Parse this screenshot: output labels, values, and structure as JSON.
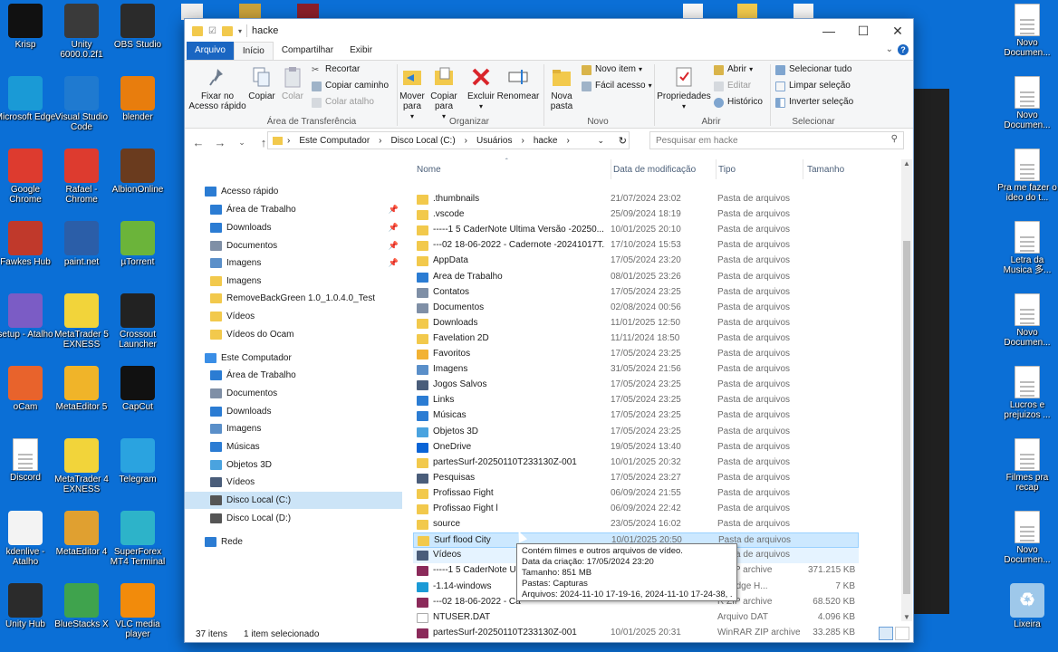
{
  "desktop": {
    "left_icons": [
      {
        "label": "Krisp",
        "icon": "krisp-icon",
        "color": "#111111"
      },
      {
        "label": "Unity 6000.0.2f1",
        "icon": "unity-icon",
        "color": "#3a3a3a"
      },
      {
        "label": "OBS Studio",
        "icon": "obs-icon",
        "color": "#2b2b2b"
      },
      {
        "label": "Microsoft Edge",
        "icon": "edge-icon",
        "color": "#1a9ad6"
      },
      {
        "label": "Visual Studio Code",
        "icon": "vscode-icon",
        "color": "#1f7ad0"
      },
      {
        "label": "blender",
        "icon": "blender-icon",
        "color": "#e87d0d"
      },
      {
        "label": "Google Chrome",
        "icon": "chrome-icon",
        "color": "#dd3b2f"
      },
      {
        "label": "Rafael - Chrome",
        "icon": "chrome-icon",
        "color": "#dd3b2f"
      },
      {
        "label": "AlbionOnline",
        "icon": "albion-icon",
        "color": "#6a3b1e"
      },
      {
        "label": "Fawkes Hub",
        "icon": "fawkes-icon",
        "color": "#c0392b"
      },
      {
        "label": "paint.net",
        "icon": "paintnet-icon",
        "color": "#2b5ea8"
      },
      {
        "label": "µTorrent",
        "icon": "utorrent-icon",
        "color": "#6bb43a"
      },
      {
        "label": "setup - Atalho",
        "icon": "setup-icon",
        "color": "#7b5cc5"
      },
      {
        "label": "MetaTrader 5 EXNESS",
        "icon": "exness-icon",
        "color": "#f2d43a"
      },
      {
        "label": "Crossout Launcher",
        "icon": "crossout-icon",
        "color": "#222222"
      },
      {
        "label": "oCam",
        "icon": "ocam-icon",
        "color": "#e8632c"
      },
      {
        "label": "MetaEditor 5",
        "icon": "metaeditor-icon",
        "color": "#f0b429"
      },
      {
        "label": "CapCut",
        "icon": "capcut-icon",
        "color": "#111111"
      },
      {
        "label": "Discord",
        "icon": "file-icon",
        "color": "#ffffff"
      },
      {
        "label": "MetaTrader 4 EXNESS",
        "icon": "exness-icon",
        "color": "#f2d43a"
      },
      {
        "label": "Telegram",
        "icon": "telegram-icon",
        "color": "#2aa3e0"
      },
      {
        "label": "kdenlive - Atalho",
        "icon": "kdenlive-icon",
        "color": "#f3f3f3"
      },
      {
        "label": "MetaEditor 4",
        "icon": "metaeditor-icon",
        "color": "#e0a030"
      },
      {
        "label": "SuperForex MT4 Terminal",
        "icon": "superforex-icon",
        "color": "#2db3c9"
      },
      {
        "label": "Unity Hub",
        "icon": "unity-icon",
        "color": "#2b2b2b"
      },
      {
        "label": "BlueStacks X",
        "icon": "bluestacks-icon",
        "color": "#3fa34d"
      },
      {
        "label": "VLC media player",
        "icon": "vlc-icon",
        "color": "#f28b0b"
      }
    ],
    "right_icons": [
      {
        "label": "Novo Documen..."
      },
      {
        "label": "Novo Documen..."
      },
      {
        "label": "Pra me fazer o ideo do t..."
      },
      {
        "label": "Letra da Musica 多..."
      },
      {
        "label": "Novo Documen..."
      },
      {
        "label": "Lucros e prejuizos ..."
      },
      {
        "label": "Filmes pra recap"
      },
      {
        "label": "Novo Documen..."
      },
      {
        "label": "Lixeira"
      }
    ]
  },
  "window": {
    "title": "hacke",
    "tabs": {
      "file": "Arquivo",
      "home": "Início",
      "share": "Compartilhar",
      "view": "Exibir"
    },
    "ribbon": {
      "pin": "Fixar no Acesso rápido",
      "copy": "Copiar",
      "paste": "Colar",
      "cut": "Recortar",
      "copy_path": "Copiar caminho",
      "paste_shortcut": "Colar atalho",
      "clipboard_group": "Área de Transferência",
      "move_to": "Mover para",
      "copy_to": "Copiar para",
      "delete": "Excluir",
      "rename": "Renomear",
      "organize_group": "Organizar",
      "new_folder": "Nova pasta",
      "new_item": "Novo item",
      "easy_access": "Fácil acesso",
      "new_group": "Novo",
      "properties": "Propriedades",
      "open": "Abrir",
      "edit": "Editar",
      "history": "Histórico",
      "open_group": "Abrir",
      "select_all": "Selecionar tudo",
      "select_none": "Limpar seleção",
      "invert": "Inverter seleção",
      "select_group": "Selecionar"
    },
    "address": {
      "crumbs": [
        "Este Computador",
        "Disco Local (C:)",
        "Usuários",
        "hacke"
      ],
      "search_placeholder": "Pesquisar em hacke"
    },
    "nav": [
      {
        "label": "Acesso rápido",
        "icon": "star-icon",
        "color": "#2b7cd3",
        "level": 0
      },
      {
        "label": "Área de Trabalho",
        "icon": "desktop-icon",
        "color": "#2b7cd3",
        "level": 1,
        "pin": true
      },
      {
        "label": "Downloads",
        "icon": "download-icon",
        "color": "#2b7cd3",
        "level": 1,
        "pin": true
      },
      {
        "label": "Documentos",
        "icon": "documents-icon",
        "color": "#7f8fa6",
        "level": 1,
        "pin": true
      },
      {
        "label": "Imagens",
        "icon": "pictures-icon",
        "color": "#5a8fc9",
        "level": 1,
        "pin": true
      },
      {
        "label": "Imagens",
        "icon": "folder-icon",
        "color": "#f2c94c",
        "level": 1
      },
      {
        "label": "RemoveBackGreen 1.0_1.0.4.0_Test",
        "icon": "folder-icon",
        "color": "#f2c94c",
        "level": 1
      },
      {
        "label": "Vídeos",
        "icon": "folder-icon",
        "color": "#f2c94c",
        "level": 1
      },
      {
        "label": "Vídeos do Ocam",
        "icon": "folder-icon",
        "color": "#f2c94c",
        "level": 1
      },
      {
        "label": "Este Computador",
        "icon": "computer-icon",
        "color": "#3a8ee6",
        "level": 0
      },
      {
        "label": "Área de Trabalho",
        "icon": "desktop-icon",
        "color": "#2b7cd3",
        "level": 1
      },
      {
        "label": "Documentos",
        "icon": "documents-icon",
        "color": "#7f8fa6",
        "level": 1
      },
      {
        "label": "Downloads",
        "icon": "download-icon",
        "color": "#2b7cd3",
        "level": 1
      },
      {
        "label": "Imagens",
        "icon": "pictures-icon",
        "color": "#5a8fc9",
        "level": 1
      },
      {
        "label": "Músicas",
        "icon": "music-icon",
        "color": "#2b7cd3",
        "level": 1
      },
      {
        "label": "Objetos 3D",
        "icon": "3d-icon",
        "color": "#4aa3df",
        "level": 1
      },
      {
        "label": "Vídeos",
        "icon": "video-icon",
        "color": "#4a5d7a",
        "level": 1
      },
      {
        "label": "Disco Local (C:)",
        "icon": "drive-icon",
        "color": "#555555",
        "level": 1,
        "selected": true
      },
      {
        "label": "Disco Local (D:)",
        "icon": "drive-icon",
        "color": "#555555",
        "level": 1
      },
      {
        "label": "Rede",
        "icon": "network-icon",
        "color": "#2b7cd3",
        "level": 0
      }
    ],
    "columns": {
      "name": "Nome",
      "date": "Data de modificação",
      "type": "Tipo",
      "size": "Tamanho"
    },
    "files": [
      {
        "name": ".thumbnails",
        "date": "21/07/2024 23:02",
        "type": "Pasta de arquivos",
        "size": "",
        "icon": "folder-icon",
        "color": "#f2c94c"
      },
      {
        "name": ".vscode",
        "date": "25/09/2024 18:19",
        "type": "Pasta de arquivos",
        "size": "",
        "icon": "folder-icon",
        "color": "#f2c94c"
      },
      {
        "name": "-----1 5 CaderNote Ultima Versão -20250...",
        "date": "10/01/2025 20:10",
        "type": "Pasta de arquivos",
        "size": "",
        "icon": "folder-icon",
        "color": "#f2c94c"
      },
      {
        "name": "---02 18-06-2022 - Cadernote -20241017T...",
        "date": "17/10/2024 15:53",
        "type": "Pasta de arquivos",
        "size": "",
        "icon": "folder-icon",
        "color": "#f2c94c"
      },
      {
        "name": "AppData",
        "date": "17/05/2024 23:20",
        "type": "Pasta de arquivos",
        "size": "",
        "icon": "folder-icon",
        "color": "#f2c94c"
      },
      {
        "name": "Área de Trabalho",
        "date": "08/01/2025 23:26",
        "type": "Pasta de arquivos",
        "size": "",
        "icon": "desktop-icon",
        "color": "#2b7cd3"
      },
      {
        "name": "Contatos",
        "date": "17/05/2024 23:25",
        "type": "Pasta de arquivos",
        "size": "",
        "icon": "contacts-icon",
        "color": "#7f8fa6"
      },
      {
        "name": "Documentos",
        "date": "02/08/2024 00:56",
        "type": "Pasta de arquivos",
        "size": "",
        "icon": "documents-icon",
        "color": "#7f8fa6"
      },
      {
        "name": "Downloads",
        "date": "11/01/2025 12:50",
        "type": "Pasta de arquivos",
        "size": "",
        "icon": "folder-icon",
        "color": "#f2c94c"
      },
      {
        "name": "Favelation 2D",
        "date": "11/11/2024 18:50",
        "type": "Pasta de arquivos",
        "size": "",
        "icon": "folder-icon",
        "color": "#f2c94c"
      },
      {
        "name": "Favoritos",
        "date": "17/05/2024 23:25",
        "type": "Pasta de arquivos",
        "size": "",
        "icon": "star-icon",
        "color": "#f2b233"
      },
      {
        "name": "Imagens",
        "date": "31/05/2024 21:56",
        "type": "Pasta de arquivos",
        "size": "",
        "icon": "pictures-icon",
        "color": "#5a8fc9"
      },
      {
        "name": "Jogos Salvos",
        "date": "17/05/2024 23:25",
        "type": "Pasta de arquivos",
        "size": "",
        "icon": "saved-games-icon",
        "color": "#4a5d7a"
      },
      {
        "name": "Links",
        "date": "17/05/2024 23:25",
        "type": "Pasta de arquivos",
        "size": "",
        "icon": "link-icon",
        "color": "#2b7cd3"
      },
      {
        "name": "Músicas",
        "date": "17/05/2024 23:25",
        "type": "Pasta de arquivos",
        "size": "",
        "icon": "music-icon",
        "color": "#2b7cd3"
      },
      {
        "name": "Objetos 3D",
        "date": "17/05/2024 23:25",
        "type": "Pasta de arquivos",
        "size": "",
        "icon": "3d-icon",
        "color": "#4aa3df"
      },
      {
        "name": "OneDrive",
        "date": "19/05/2024 13:40",
        "type": "Pasta de arquivos",
        "size": "",
        "icon": "onedrive-icon",
        "color": "#0a64d6"
      },
      {
        "name": "partesSurf-20250110T233130Z-001",
        "date": "10/01/2025 20:32",
        "type": "Pasta de arquivos",
        "size": "",
        "icon": "folder-icon",
        "color": "#f2c94c"
      },
      {
        "name": "Pesquisas",
        "date": "17/05/2024 23:27",
        "type": "Pasta de arquivos",
        "size": "",
        "icon": "search-icon",
        "color": "#4a5d7a"
      },
      {
        "name": "Profissao Fight",
        "date": "06/09/2024 21:55",
        "type": "Pasta de arquivos",
        "size": "",
        "icon": "folder-icon",
        "color": "#f2c94c"
      },
      {
        "name": "Profissao Fight l",
        "date": "06/09/2024 22:42",
        "type": "Pasta de arquivos",
        "size": "",
        "icon": "folder-icon",
        "color": "#f2c94c"
      },
      {
        "name": "source",
        "date": "23/05/2024 16:02",
        "type": "Pasta de arquivos",
        "size": "",
        "icon": "folder-icon",
        "color": "#f2c94c"
      },
      {
        "name": "Surf flood City",
        "date": "10/01/2025 20:50",
        "type": "Pasta de arquivos",
        "size": "",
        "icon": "folder-icon",
        "color": "#f2c94c",
        "selected": true
      },
      {
        "name": "Vídeos",
        "date": "08/01/2025 18:13",
        "type": "Pasta de arquivos",
        "size": "",
        "icon": "video-icon",
        "color": "#4a5d7a",
        "hover": true
      },
      {
        "name": "-----1 5 CaderNote Ul",
        "date": "",
        "type": "R ZIP archive",
        "size": "371.215 KB",
        "icon": "winrar-icon",
        "color": "#8b2a5a"
      },
      {
        "name": "-1.14-windows",
        "date": "",
        "type": "oft Edge H...",
        "size": "7 KB",
        "icon": "edge-icon",
        "color": "#1a9ad6"
      },
      {
        "name": "---02 18-06-2022 - Ca",
        "date": "",
        "type": "R ZIP archive",
        "size": "68.520 KB",
        "icon": "winrar-icon",
        "color": "#8b2a5a"
      },
      {
        "name": "NTUSER.DAT",
        "date": "",
        "type": "Arquivo DAT",
        "size": "4.096 KB",
        "icon": "file-icon",
        "color": "#ffffff"
      },
      {
        "name": "partesSurf-20250110T233130Z-001",
        "date": "10/01/2025 20:31",
        "type": "WinRAR ZIP archive",
        "size": "33.285 KB",
        "icon": "winrar-icon",
        "color": "#8b2a5a"
      }
    ],
    "tooltip": [
      "Contém filmes e outros arquivos de vídeo.",
      "Data da criação: 17/05/2024 23:20",
      "Tamanho: 851 MB",
      "Pastas: Capturas",
      "Arquivos: 2024-11-10 17-19-16, 2024-11-10 17-24-38, ..."
    ],
    "status": {
      "count": "37 itens",
      "selected": "1 item selecionado"
    }
  }
}
